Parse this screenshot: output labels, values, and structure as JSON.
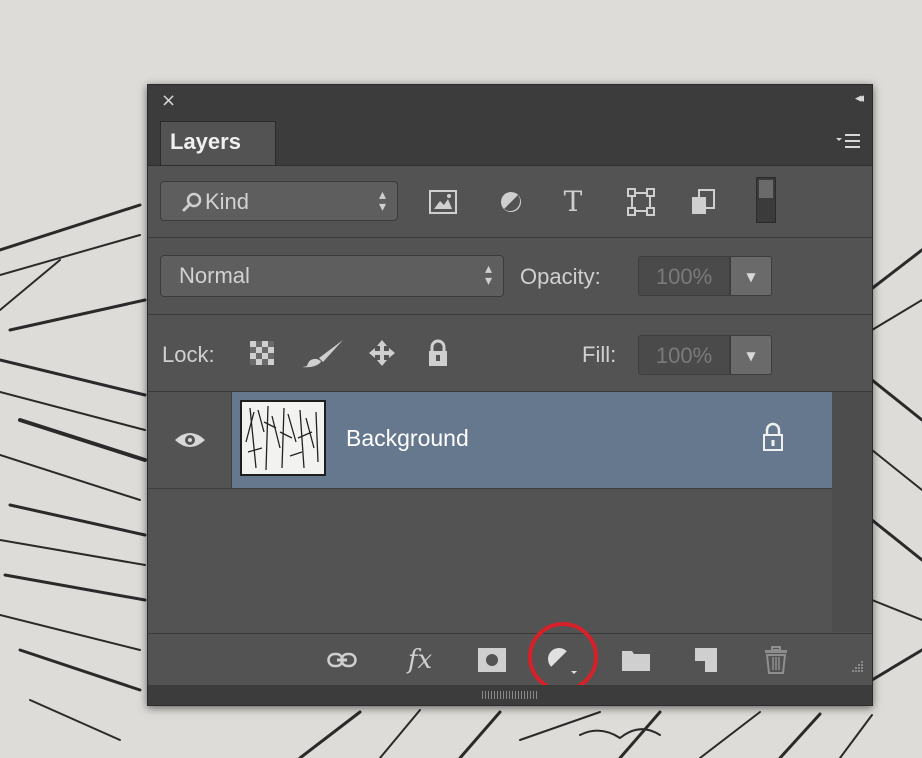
{
  "panel": {
    "close_glyph": "×",
    "collapse_glyph": "◂◂",
    "tab_label": "Layers",
    "menu_icon": "panel-menu-icon"
  },
  "filter_row": {
    "kind_label": "Kind",
    "icons": [
      "pixel-layer-filter-icon",
      "adjustment-layer-filter-icon",
      "type-layer-filter-icon",
      "shape-layer-filter-icon",
      "smart-object-filter-icon"
    ],
    "type_glyph": "T"
  },
  "blend_row": {
    "blend_mode": "Normal",
    "opacity_label": "Opacity:",
    "opacity_value": "100%"
  },
  "lock_row": {
    "lock_label": "Lock:",
    "fill_label": "Fill:",
    "fill_value": "100%"
  },
  "layers": [
    {
      "name": "Background",
      "visible": true,
      "locked": true,
      "selected": true
    }
  ],
  "footer": {
    "fx_label": "fx",
    "icons": [
      "link-layers-icon",
      "layer-style-icon",
      "add-mask-icon",
      "adjustment-layer-icon",
      "new-group-icon",
      "new-layer-icon",
      "delete-layer-icon"
    ],
    "highlighted": "adjustment-layer-icon",
    "highlight_color": "#d6212a"
  },
  "colors": {
    "panel_bg": "#535353",
    "titlebar_bg": "#3c3c3c",
    "selected_layer": "#66788e"
  }
}
